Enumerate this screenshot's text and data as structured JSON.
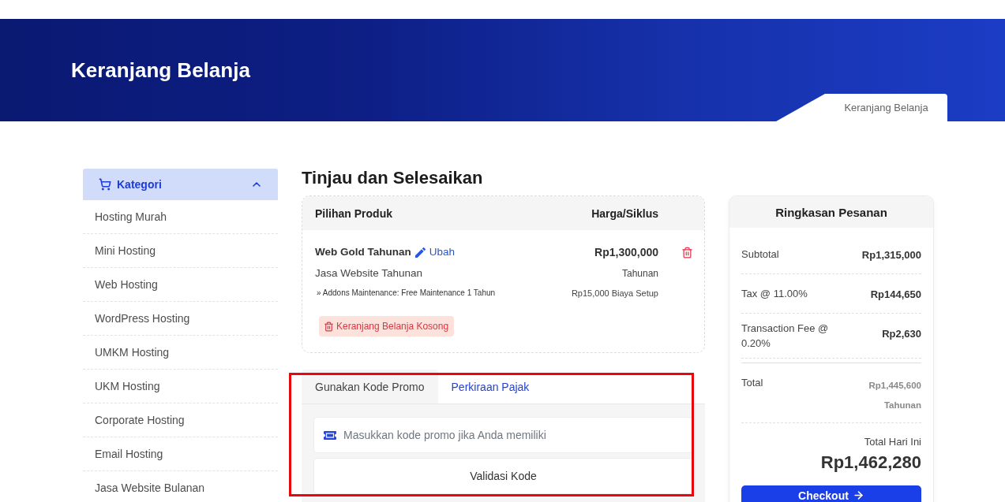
{
  "banner": {
    "title": "Keranjang Belanja",
    "breadcrumb": "Keranjang Belanja"
  },
  "sidebar": {
    "title": "Kategori",
    "expanded": true,
    "items": [
      {
        "label": "Hosting Murah"
      },
      {
        "label": "Mini Hosting"
      },
      {
        "label": "Web Hosting"
      },
      {
        "label": "WordPress Hosting"
      },
      {
        "label": "UMKM Hosting"
      },
      {
        "label": "UKM Hosting"
      },
      {
        "label": "Corporate Hosting"
      },
      {
        "label": "Email Hosting"
      },
      {
        "label": "Jasa Website Bulanan"
      }
    ]
  },
  "review": {
    "title": "Tinjau dan Selesaikan",
    "columns": [
      "Pilihan Produk",
      "Harga/Siklus"
    ],
    "items": [
      {
        "name": "Web Gold Tahunan",
        "edit_label": "Ubah",
        "group": "Jasa Website Tahunan",
        "addon": "» Addons Maintenance: Free Maintenance 1 Tahun",
        "price": "Rp1,300,000",
        "cycle": "Tahunan",
        "setup_fee": "Rp15,000 Biaya Setup"
      }
    ],
    "empty_cart_button": "Keranjang Belanja Kosong"
  },
  "promo": {
    "highlighted": true,
    "tabs": [
      {
        "label": "Gunakan Kode Promo",
        "selected": true
      },
      {
        "label": "Perkiraan Pajak",
        "selected": false
      }
    ],
    "placeholder": "Masukkan kode promo jika Anda memiliki",
    "button": "Validasi Kode"
  },
  "summary": {
    "title": "Ringkasan Pesanan",
    "lines": [
      {
        "label": "Subtotal",
        "value": "Rp1,315,000"
      },
      {
        "label": "Tax @ 11.00%",
        "value": "Rp144,650"
      },
      {
        "label": "Transaction Fee @ 0.20%",
        "value": "Rp2,630"
      }
    ],
    "total": {
      "label": "Total",
      "value": "Rp1,445,600",
      "cycle": "Tahunan"
    },
    "today": {
      "label": "Total Hari Ini",
      "value": "Rp1,462,280"
    },
    "checkout": "Checkout"
  }
}
